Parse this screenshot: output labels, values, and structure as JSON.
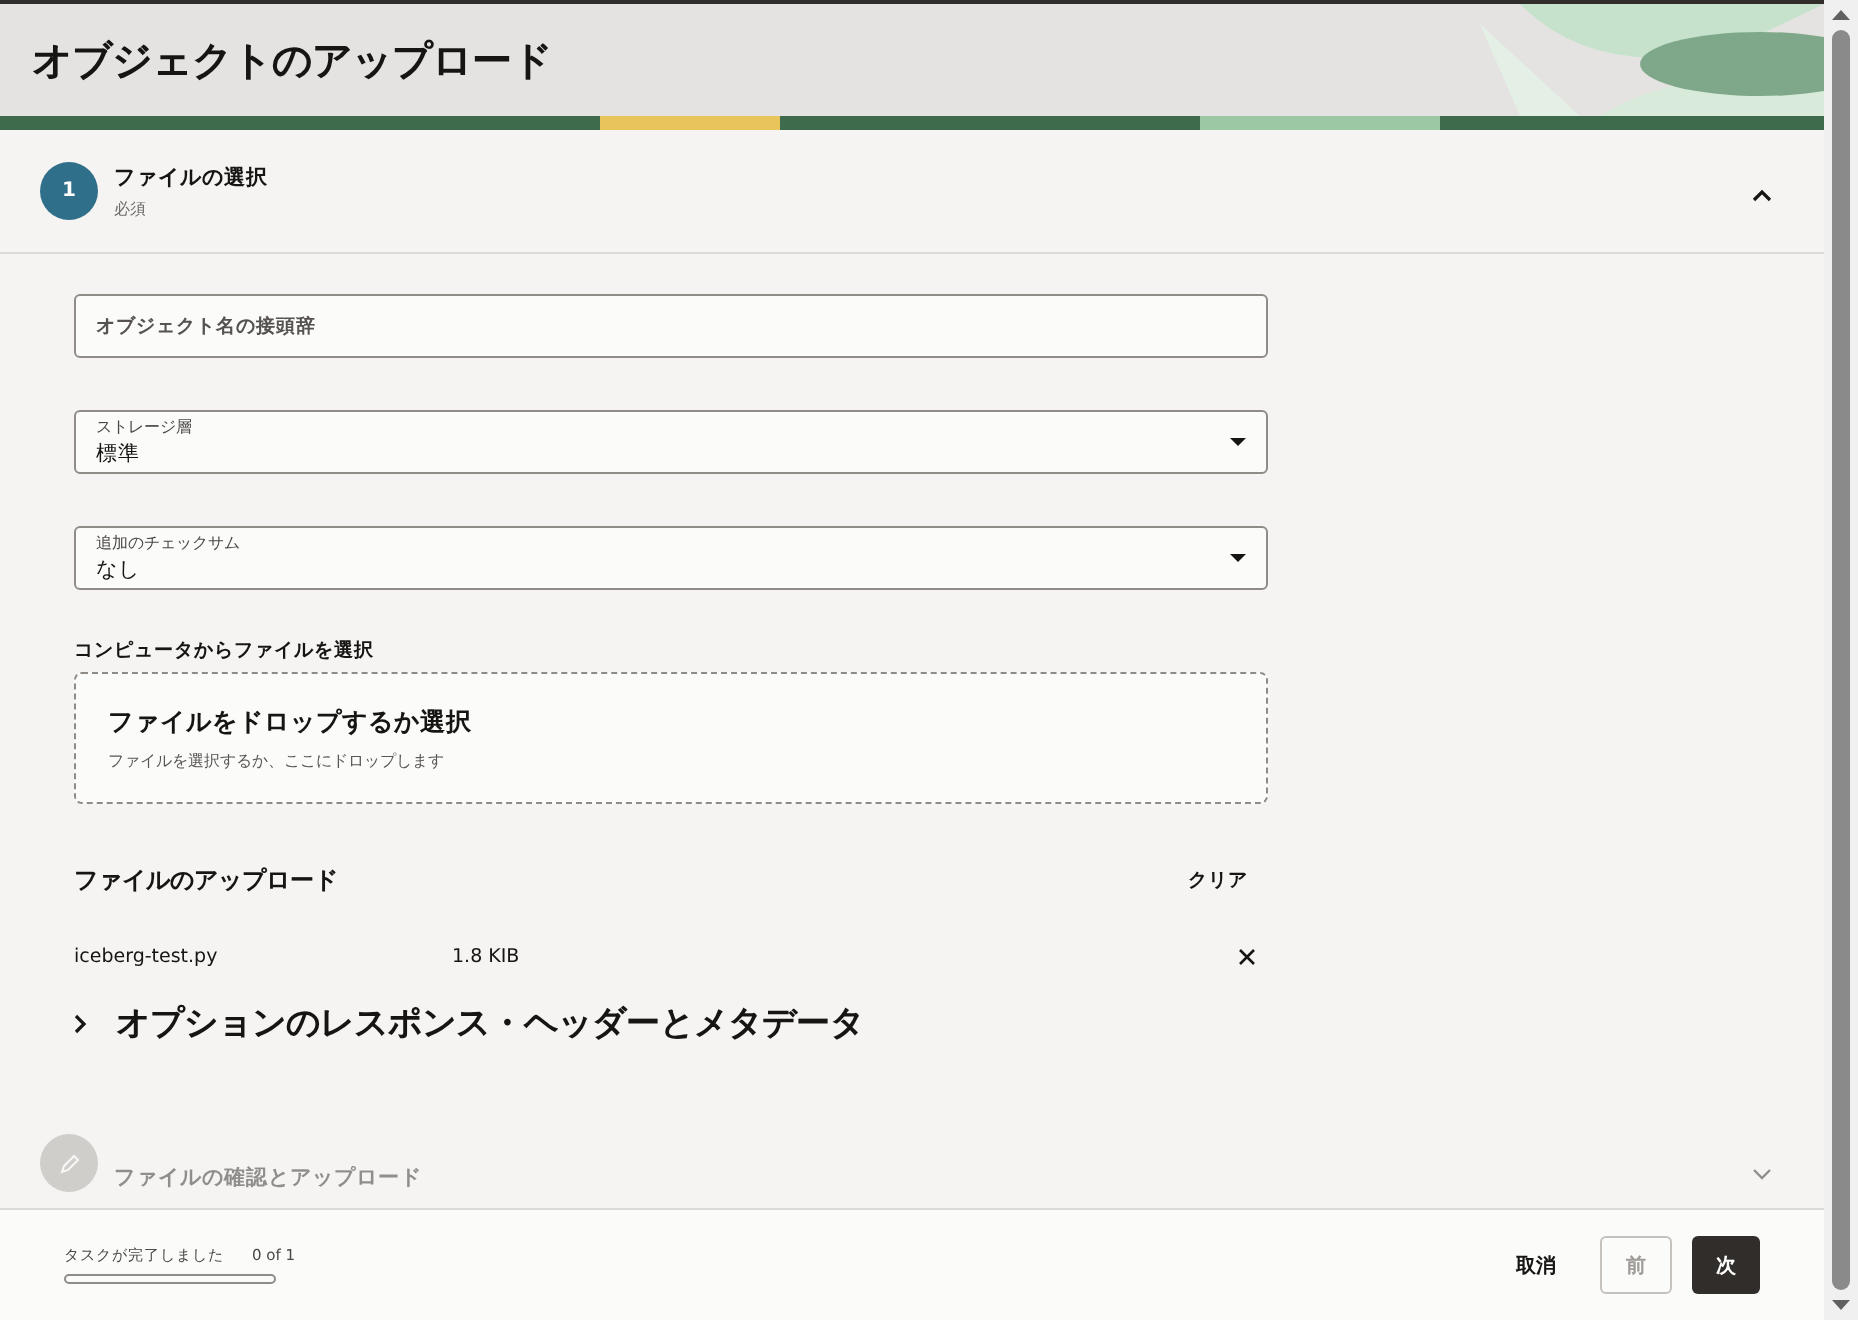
{
  "header": {
    "title": "オブジェクトのアップロード"
  },
  "steps": [
    {
      "number": "1",
      "title": "ファイルの選択",
      "subtitle": "必須",
      "expanded": true,
      "disabled": false
    },
    {
      "title": "ファイルの確認とアップロード",
      "expanded": false,
      "disabled": true
    }
  ],
  "form": {
    "prefix_field": {
      "placeholder": "オブジェクト名の接頭辞"
    },
    "selects": [
      {
        "label": "ストレージ層",
        "value": "標準"
      },
      {
        "label": "追加のチェックサム",
        "value": "なし"
      }
    ],
    "file_picker": {
      "label": "コンピュータからファイルを選択",
      "title": "ファイルをドロップするか選択",
      "hint": "ファイルを選択するか、ここにドロップします"
    },
    "uploads": {
      "title": "ファイルのアップロード",
      "clear": "クリア",
      "files": [
        {
          "name": "iceberg-test.py",
          "size": "1.8 KIB"
        }
      ]
    },
    "options": {
      "title": "オプションのレスポンス・ヘッダーとメタデータ",
      "expanded": false
    }
  },
  "footer": {
    "status": "タスクが完了しました",
    "count": "0 of 1",
    "level": 0,
    "buttons": [
      {
        "label": "取消",
        "kind": "text",
        "disabled": false
      },
      {
        "label": "前",
        "kind": "outline",
        "disabled": true
      },
      {
        "label": "次",
        "kind": "primary",
        "disabled": false
      }
    ]
  }
}
